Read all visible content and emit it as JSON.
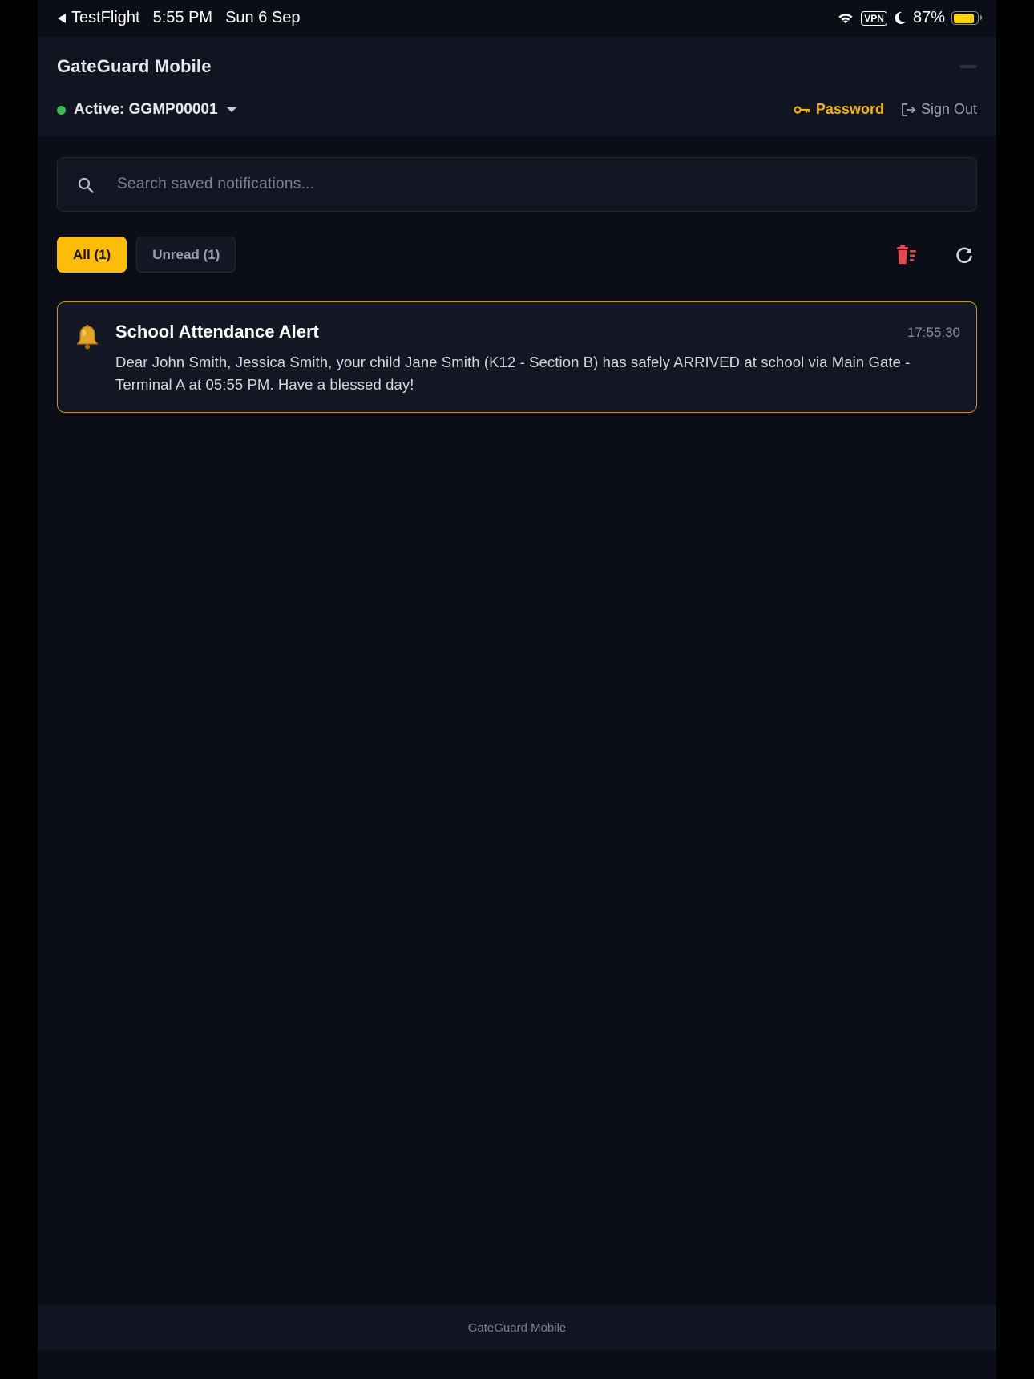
{
  "status_bar": {
    "back_app": "TestFlight",
    "time": "5:55 PM",
    "date": "Sun 6 Sep",
    "vpn": "VPN",
    "battery": "87%",
    "battery_level": 0.87,
    "battery_color": "#ffd60a"
  },
  "header": {
    "title": "GateGuard Mobile",
    "active_label": "Active: GGMP00001",
    "password_label": "Password",
    "signout_label": "Sign Out"
  },
  "search": {
    "placeholder": "Search saved notifications...",
    "value": ""
  },
  "tabs": [
    {
      "label": "All (1)",
      "active": true
    },
    {
      "label": "Unread (1)",
      "active": false
    }
  ],
  "icons": {
    "clear_all": "delete-sweep-icon",
    "refresh": "refresh-icon",
    "notification": "bell-icon"
  },
  "notifications": [
    {
      "title": "School Attendance Alert",
      "time": "17:55:30",
      "body": "Dear John Smith, Jessica Smith, your child Jane Smith (K12 - Section B) has safely ARRIVED at school via Main Gate - Terminal A at 05:55 PM. Have a blessed day!"
    }
  ],
  "footer": {
    "text": "GateGuard Mobile"
  },
  "colors": {
    "accent": "#fbbc0a",
    "background": "#0b0e16",
    "surface": "#111522",
    "online": "#3fb950",
    "danger": "#e5484d"
  }
}
